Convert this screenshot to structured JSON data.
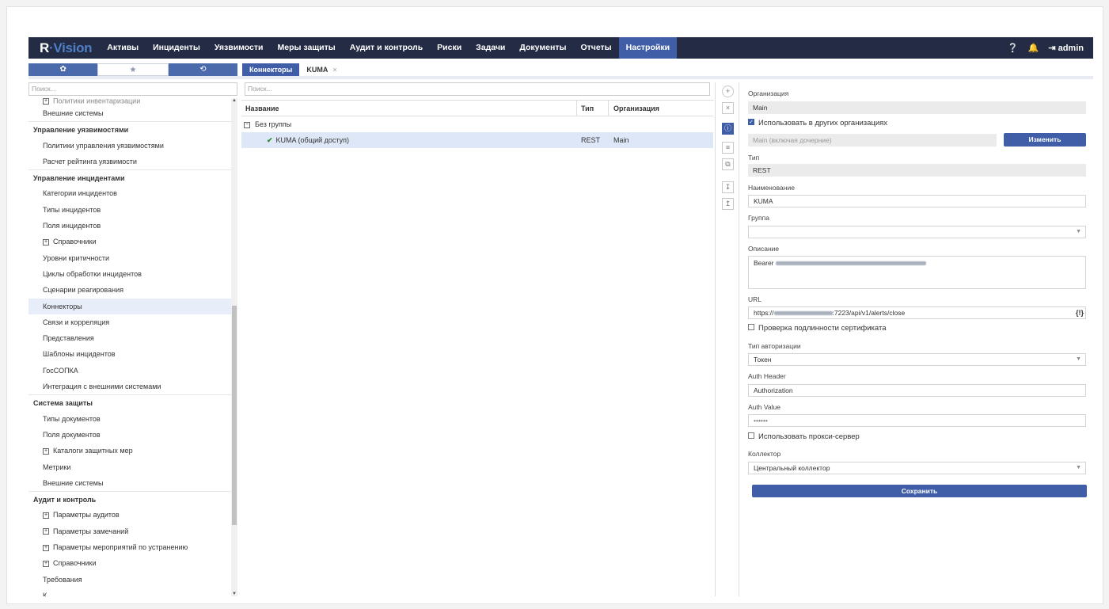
{
  "app": {
    "logo_r": "R",
    "logo_sep": "·",
    "logo_v": "Vision",
    "nav": [
      "Активы",
      "Инциденты",
      "Уязвимости",
      "Меры защиты",
      "Аудит и контроль",
      "Риски",
      "Задачи",
      "Документы",
      "Отчеты",
      "Настройки"
    ],
    "user": "admin"
  },
  "left_tabs": [
    "✿",
    "★",
    "⟲"
  ],
  "content_tabs": {
    "t1": "Коннекторы",
    "t2": "KUMA",
    "close": "×"
  },
  "left": {
    "search_placeholder": "Поиск...",
    "items": [
      {
        "label": "Политики инвентаризации",
        "type": "cut"
      },
      {
        "label": "Внешние системы",
        "type": "item"
      },
      {
        "label": "Управление уязвимостями",
        "type": "hdr"
      },
      {
        "label": "Политики управления уязвимостями",
        "type": "item"
      },
      {
        "label": "Расчет рейтинга уязвимости",
        "type": "item"
      },
      {
        "label": "Управление инцидентами",
        "type": "hdr"
      },
      {
        "label": "Категории инцидентов",
        "type": "item"
      },
      {
        "label": "Типы инцидентов",
        "type": "item"
      },
      {
        "label": "Поля инцидентов",
        "type": "item"
      },
      {
        "label": "Справочники",
        "type": "plus"
      },
      {
        "label": "Уровни критичности",
        "type": "item"
      },
      {
        "label": "Циклы обработки инцидентов",
        "type": "item"
      },
      {
        "label": "Сценарии реагирования",
        "type": "item"
      },
      {
        "label": "Коннекторы",
        "type": "sel"
      },
      {
        "label": "Связи и корреляция",
        "type": "item"
      },
      {
        "label": "Представления",
        "type": "item"
      },
      {
        "label": "Шаблоны инцидентов",
        "type": "item"
      },
      {
        "label": "ГосСОПКА",
        "type": "item"
      },
      {
        "label": "Интеграция с внешними системами",
        "type": "item"
      },
      {
        "label": "Система защиты",
        "type": "hdr"
      },
      {
        "label": "Типы документов",
        "type": "item"
      },
      {
        "label": "Поля документов",
        "type": "item"
      },
      {
        "label": "Каталоги защитных мер",
        "type": "plus"
      },
      {
        "label": "Метрики",
        "type": "item"
      },
      {
        "label": "Внешние системы",
        "type": "item"
      },
      {
        "label": "Аудит и контроль",
        "type": "hdr"
      },
      {
        "label": "Параметры аудитов",
        "type": "plus"
      },
      {
        "label": "Параметры замечаний",
        "type": "plus"
      },
      {
        "label": "Параметры мероприятий по устранению",
        "type": "plus"
      },
      {
        "label": "Справочники",
        "type": "plus"
      },
      {
        "label": "Требования",
        "type": "item"
      },
      {
        "label": "К...",
        "type": "item"
      }
    ]
  },
  "grid": {
    "search_placeholder": "Поиск...",
    "col_name": "Название",
    "col_type": "Тип",
    "col_org": "Организация",
    "group": "Без группы",
    "row": {
      "name": "KUMA (общий доступ)",
      "type": "REST",
      "org": "Main"
    }
  },
  "form": {
    "org_label": "Организация",
    "org_value": "Main",
    "use_other_label": "Использовать в других организациях",
    "orgs_placeholder": "Main (включая дочерние)",
    "change_button": "Изменить",
    "type_label": "Тип",
    "type_value": "REST",
    "name_label": "Наименование",
    "name_value": "KUMA",
    "group_label": "Группа",
    "group_value": "",
    "desc_label": "Описание",
    "desc_value": "Bearer",
    "url_label": "URL",
    "url_prefix": "https://",
    "url_suffix": ":7223/api/v1/alerts/close",
    "url_icon": "{!}",
    "cert_label": "Проверка подлинности сертификата",
    "auth_type_label": "Тип авторизации",
    "auth_type_value": "Токен",
    "auth_header_label": "Auth Header",
    "auth_header_value": "Authorization",
    "auth_value_label": "Auth Value",
    "auth_value_value": "••••••",
    "proxy_label": "Использовать прокси-сервер",
    "collector_label": "Коллектор",
    "collector_value": "Центральный коллектор",
    "save_button": "Сохранить"
  },
  "colors": {
    "nav_bg": "#232b45",
    "accent": "#3f5ea7",
    "selected_row": "#dde7f7"
  }
}
